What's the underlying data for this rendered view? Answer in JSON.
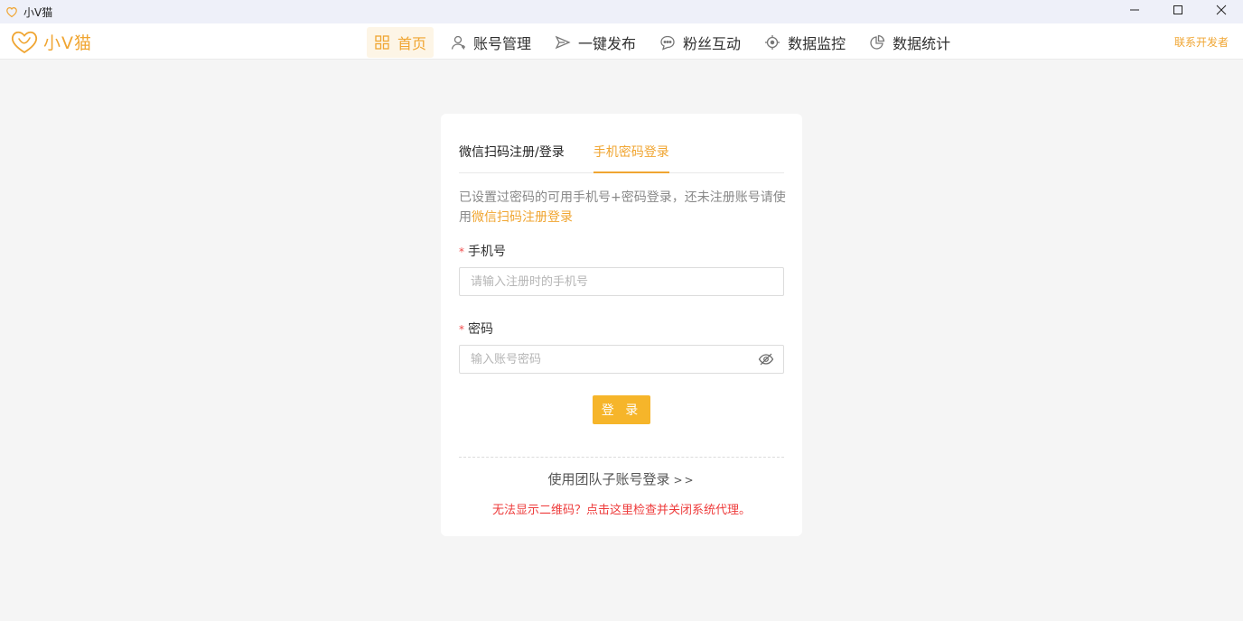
{
  "window": {
    "title": "小V猫"
  },
  "brand": {
    "name": "小V猫",
    "accent_color": "#f0a531"
  },
  "nav": {
    "items": [
      {
        "label": "首页",
        "icon": "grid-icon",
        "active": true
      },
      {
        "label": "账号管理",
        "icon": "user-icon",
        "active": false
      },
      {
        "label": "一键发布",
        "icon": "send-icon",
        "active": false
      },
      {
        "label": "粉丝互动",
        "icon": "chat-icon",
        "active": false
      },
      {
        "label": "数据监控",
        "icon": "target-icon",
        "active": false
      },
      {
        "label": "数据统计",
        "icon": "pie-chart-icon",
        "active": false
      }
    ],
    "contact": "联系开发者"
  },
  "login": {
    "tabs": [
      {
        "label": "微信扫码注册/登录",
        "active": false
      },
      {
        "label": "手机密码登录",
        "active": true
      }
    ],
    "hint_text": "已设置过密码的可用手机号+密码登录，还未注册账号请使用",
    "hint_link": "微信扫码注册登录",
    "required_mark": "*",
    "phone": {
      "label": "手机号",
      "placeholder": "请输入注册时的手机号",
      "value": ""
    },
    "password": {
      "label": "密码",
      "placeholder": "输入账号密码",
      "value": ""
    },
    "submit_label": "登 录",
    "team_login_text": "使用团队子账号登录",
    "team_login_arrows": ">>",
    "qr_warning": "无法显示二维码？点击这里检查并关闭系统代理。"
  },
  "colors": {
    "accent": "#f0a531",
    "button": "#f6b52a",
    "warning": "#ee3b3b",
    "background": "#f5f5f5"
  }
}
